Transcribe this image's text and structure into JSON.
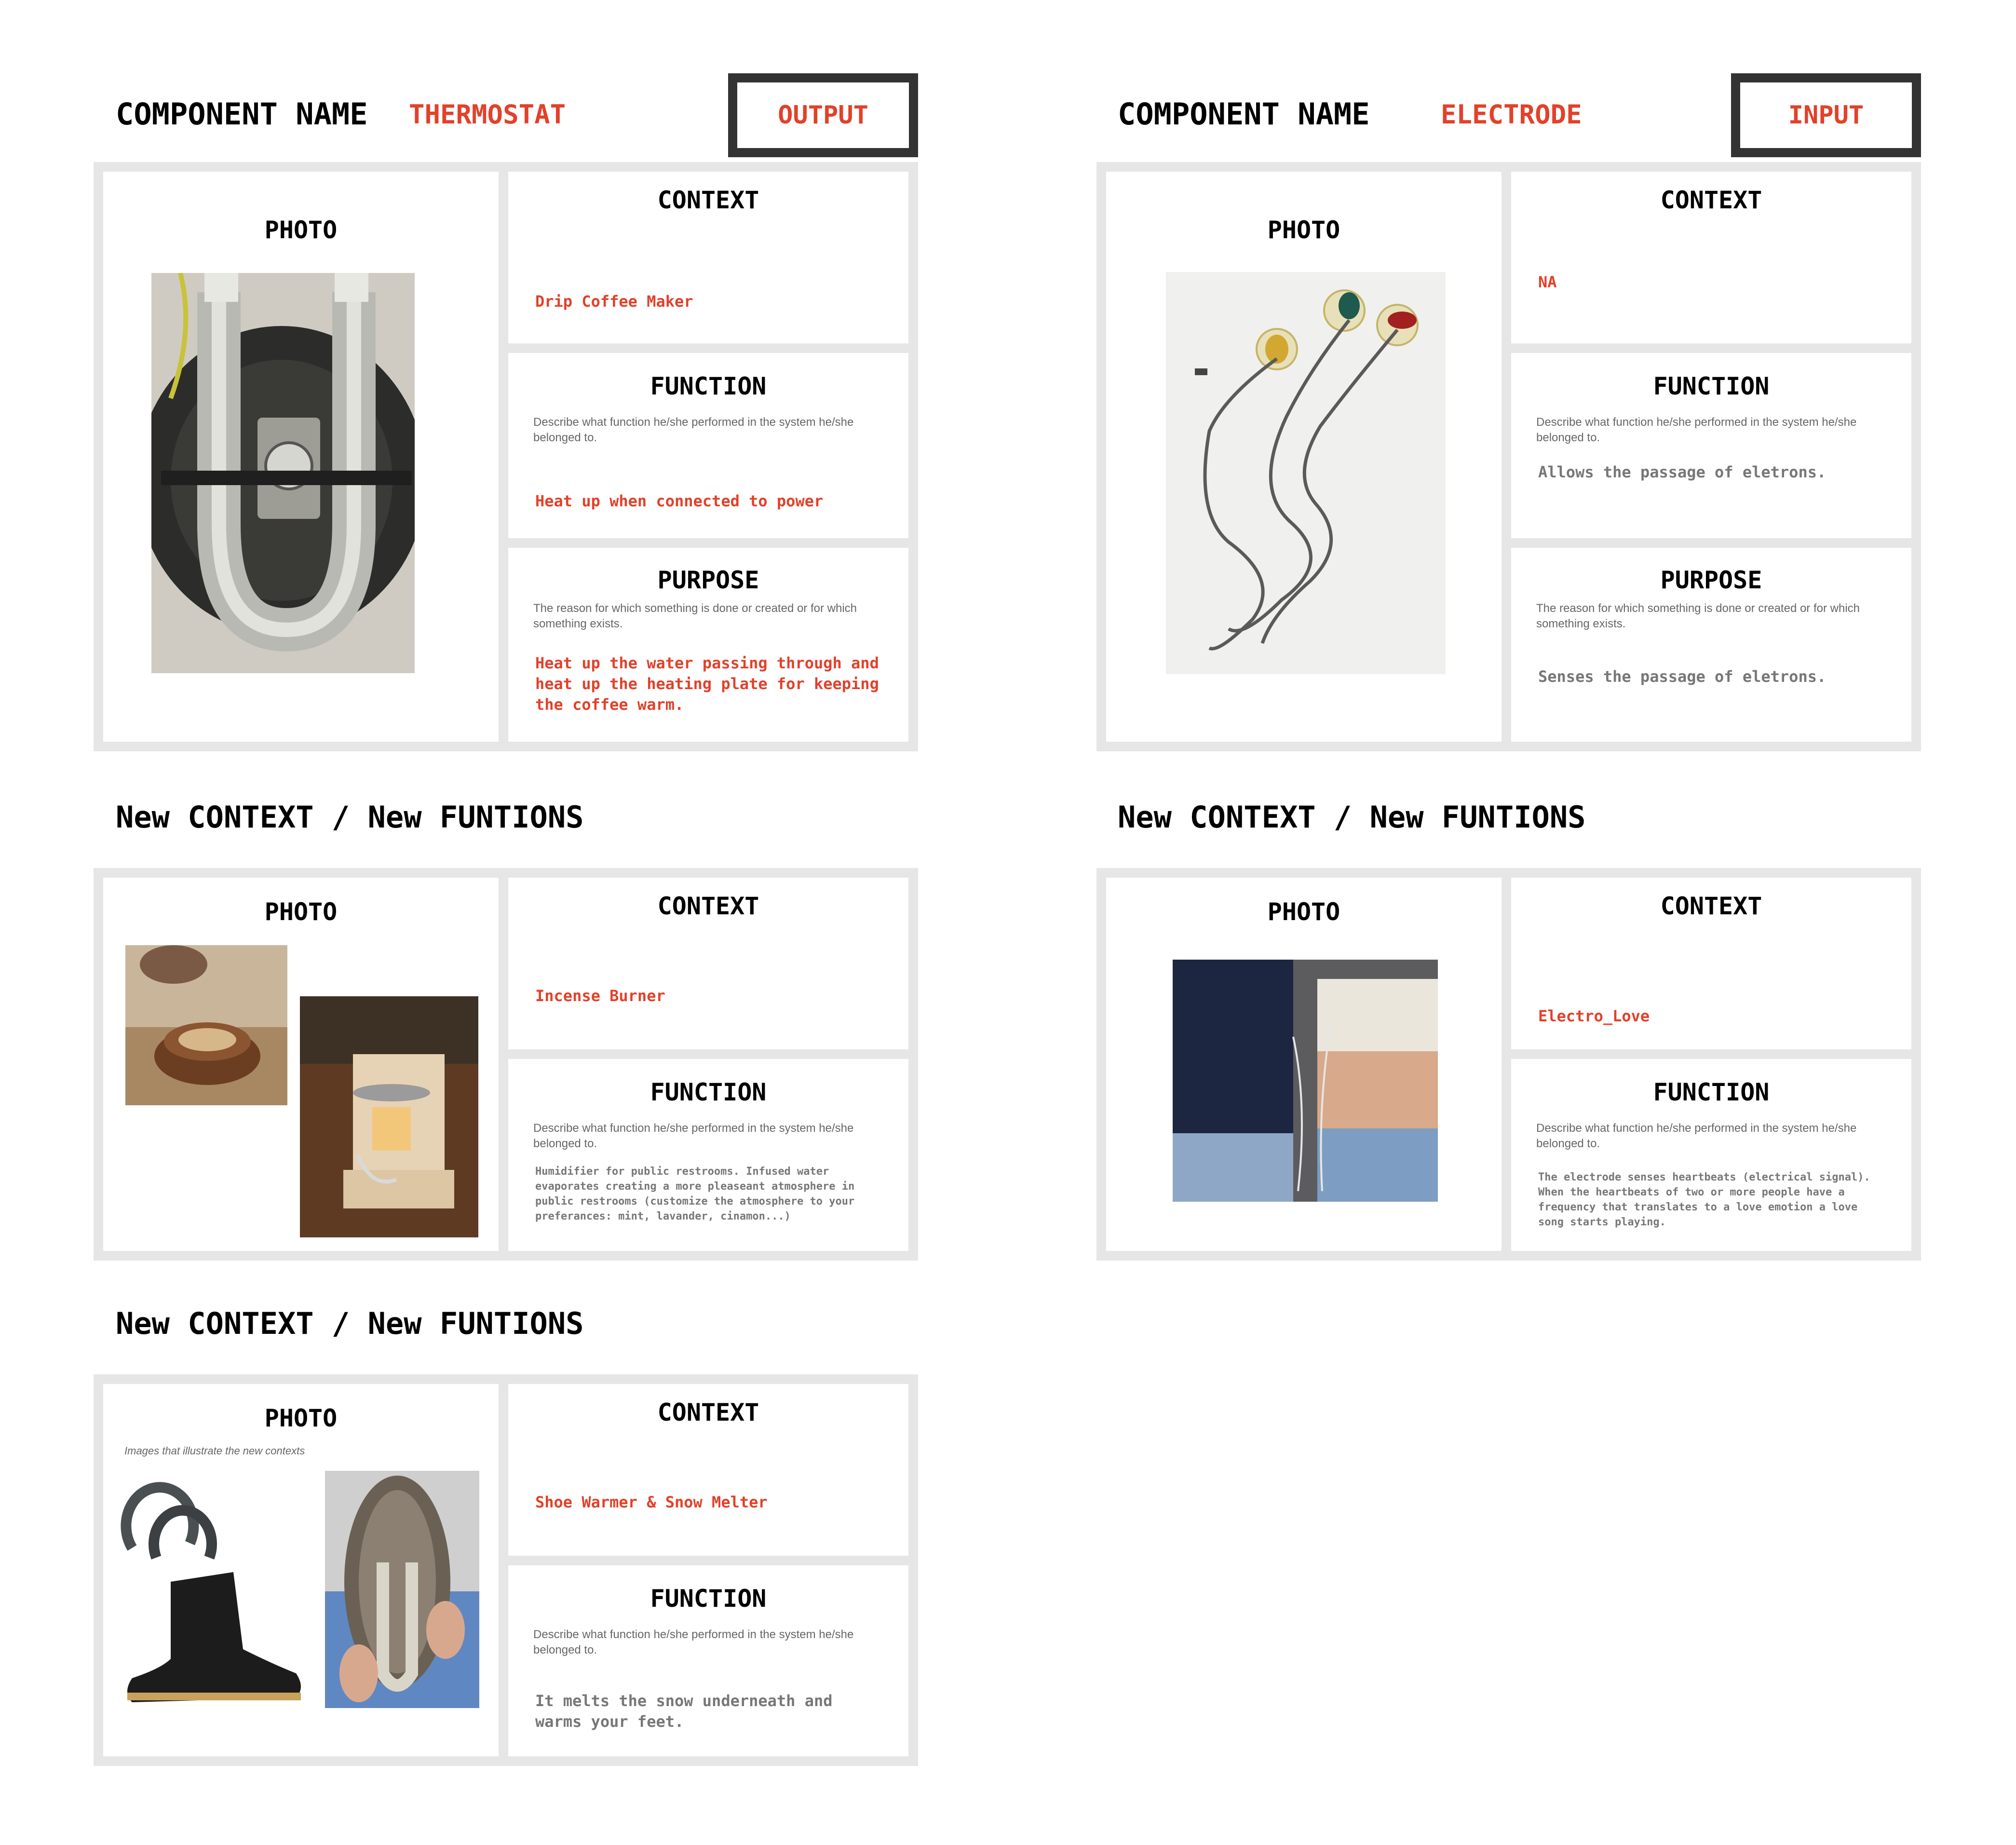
{
  "thermostat": {
    "component_label": "COMPONENT NAME",
    "component_name": "THERMOSTAT",
    "io": "OUTPUT",
    "photo_title": "PHOTO",
    "context_title": "CONTEXT",
    "context_value": "Drip Coffee Maker",
    "function_title": "FUNCTION",
    "function_desc": "Describe what function he/she performed in the system he/she belonged to.",
    "function_value": "Heat up when connected to power",
    "purpose_title": "PURPOSE",
    "purpose_desc": "The reason for which something is done or created or for which something exists.",
    "purpose_value": "Heat up the water passing through and\nheat up the heating plate for keeping\nthe coffee warm."
  },
  "electrode": {
    "component_label": "COMPONENT NAME",
    "component_name": "ELECTRODE",
    "io": "INPUT",
    "photo_title": "PHOTO",
    "context_title": "CONTEXT",
    "context_value": "NA",
    "function_title": "FUNCTION",
    "function_desc": "Describe what function he/she performed in the system he/she belonged to.",
    "function_value": "Allows the passage of eletrons.",
    "purpose_title": "PURPOSE",
    "purpose_desc": "The reason for which something is done or created or for which something exists.",
    "purpose_value": "Senses the passage of eletrons."
  },
  "new_section_title": "New CONTEXT / New FUNTIONS",
  "incense": {
    "photo_title": "PHOTO",
    "context_title": "CONTEXT",
    "context_value": "Incense Burner",
    "function_title": "FUNCTION",
    "function_desc": "Describe what function he/she performed in the system he/she belonged to.",
    "function_value": "Humidifier for public restrooms. Infused water\nevaporates creating a more pleaseant atmosphere in\npublic restrooms (customize the atmosphere to your\npreferances: mint, lavander, cinamon...)"
  },
  "electro_love": {
    "photo_title": "PHOTO",
    "context_title": "CONTEXT",
    "context_value": "Electro_Love",
    "function_title": "FUNCTION",
    "function_desc": "Describe what function he/she performed in the system he/she belonged to.",
    "function_value": "The electrode senses heartbeats (electrical signal).\nWhen the heartbeats of two or more people have a\nfrequency that translates to a love emotion a love\nsong starts playing."
  },
  "shoe": {
    "photo_title": "PHOTO",
    "photo_caption": "Images that illustrate the new contexts",
    "context_title": "CONTEXT",
    "context_value": "Shoe Warmer & Snow Melter",
    "function_title": "FUNCTION",
    "function_desc": "Describe what function he/she performed in the system he/she belonged to.",
    "function_value": "It melts the snow underneath and\nwarms your feet."
  }
}
